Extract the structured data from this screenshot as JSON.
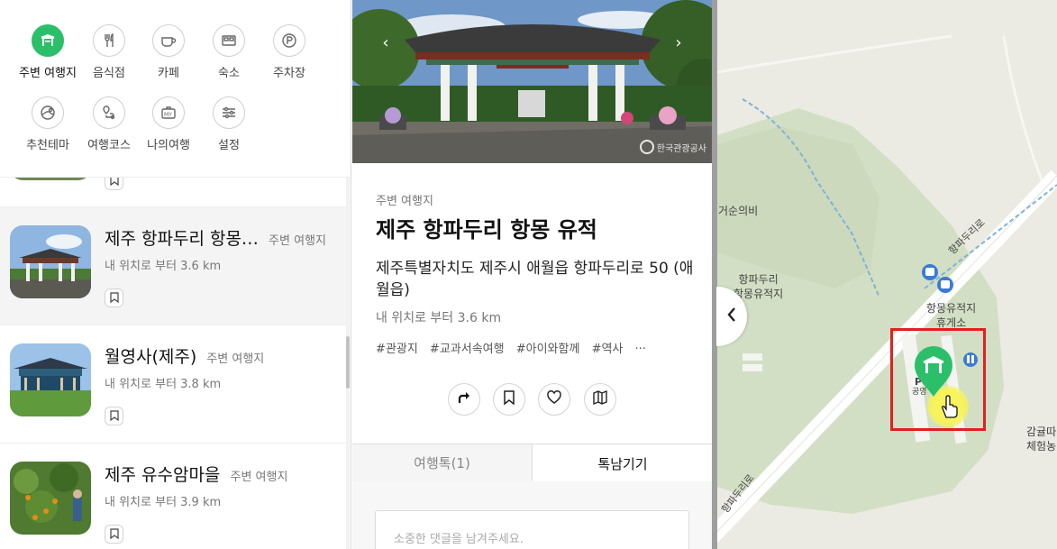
{
  "categories": [
    {
      "label": "주변 여행지",
      "icon": "gate-icon",
      "active": true
    },
    {
      "label": "음식점",
      "icon": "fork-knife-icon",
      "active": false
    },
    {
      "label": "카페",
      "icon": "coffee-cup-icon",
      "active": false
    },
    {
      "label": "숙소",
      "icon": "bed-icon",
      "active": false
    },
    {
      "label": "주차장",
      "icon": "parking-icon",
      "active": false
    },
    {
      "label": "추천테마",
      "icon": "theme-icon",
      "active": false
    },
    {
      "label": "여행코스",
      "icon": "route-icon",
      "active": false
    },
    {
      "label": "나의여행",
      "icon": "my-trip-icon",
      "active": false
    },
    {
      "label": "설정",
      "icon": "settings-sliders-icon",
      "active": false
    }
  ],
  "list": [
    {
      "title": "제주 항파두리 항몽…",
      "category": "주변 여행지",
      "distance": "내 위치로 부터 3.6 km",
      "selected": true
    },
    {
      "title": "월영사(제주)",
      "category": "주변 여행지",
      "distance": "내 위치로 부터 3.8 km",
      "selected": false
    },
    {
      "title": "제주 유수암마을",
      "category": "주변 여행지",
      "distance": "내 위치로 부터 3.9 km",
      "selected": false
    }
  ],
  "detail": {
    "watermark": "한국관광공사",
    "category": "주변 여행지",
    "title": "제주 항파두리 항몽 유적",
    "address": "제주특별자치도 제주시 애월읍 항파두리로 50 (애월읍)",
    "distance": "내 위치로 부터 3.6 km",
    "tags": [
      "#관광지",
      "#교과서속여행",
      "#아이와함께",
      "#역사",
      "···"
    ],
    "tabs": {
      "talk": "여행톡(1)",
      "comment": "톡남기기"
    },
    "comment_placeholder": "소중한 댓글을 남겨주세요."
  },
  "map": {
    "labels": {
      "geosun": "거순의비",
      "site": "항파두리\n항몽유적지",
      "rest": "항몽유적지\n휴게소",
      "parking_p": "P",
      "parking_name": "공영",
      "road_top": "항파두리로",
      "road_bottom": "항파두리로",
      "farm": "감귤따\n체험농"
    },
    "colors": {
      "marker": "#2bbf6a",
      "highlight": "#e02020",
      "bus": "#3a7bd5"
    }
  }
}
